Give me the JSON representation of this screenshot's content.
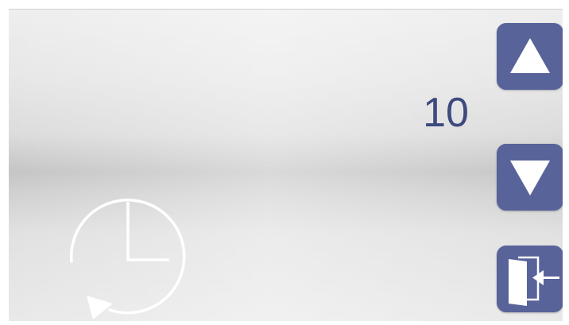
{
  "display": {
    "value": "10"
  },
  "icons": {
    "timer": "clock-with-cycle-arrow-icon",
    "up": "triangle-up-icon",
    "down": "triangle-down-icon",
    "exit": "door-exit-icon"
  },
  "colors": {
    "accent": "#58639a",
    "value_text": "#3c4a7e",
    "icon_fill": "#ffffff"
  }
}
